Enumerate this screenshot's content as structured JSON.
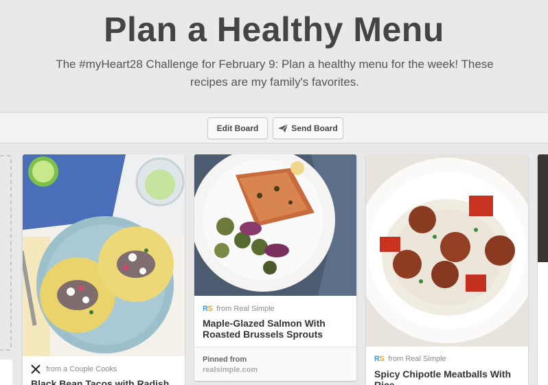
{
  "header": {
    "title": "Plan a Healthy Menu",
    "description": "The #myHeart28 Challenge for February 9: Plan a healthy menu for the week! These recipes are my family's favorites."
  },
  "toolbar": {
    "edit_label": "Edit Board",
    "send_label": "Send Board"
  },
  "pins": [
    {
      "source_label": "from a Couple Cooks",
      "title": "Black Bean Tacos with Radish",
      "image": "black bean tacos on blue plate"
    },
    {
      "source_logo": "RS",
      "source_label": "from Real Simple",
      "title": "Maple-Glazed Salmon With Roasted Brussels Sprouts",
      "pinned_label": "Pinned from",
      "pinned_link": "realsimple.com",
      "image": "salmon with brussels sprouts"
    },
    {
      "source_logo": "RS",
      "source_label": "from Real Simple",
      "title": "Spicy Chipotle Meatballs With Rice",
      "image": "meatballs over rice"
    }
  ],
  "colors": {
    "background": "#e9e9e9",
    "title": "#444444",
    "rs_blue": "#3a9ad9",
    "rs_orange": "#f0a830"
  },
  "icons": {
    "send": "paper-plane-icon",
    "couple_cooks": "crossed-utensils-icon"
  }
}
